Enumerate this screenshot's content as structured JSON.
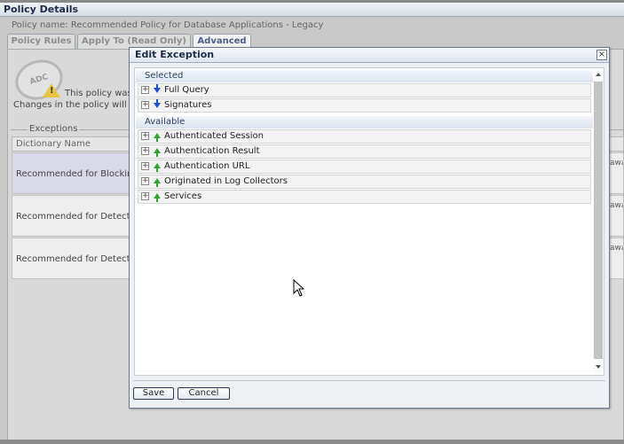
{
  "window": {
    "title": "Policy Details"
  },
  "policy": {
    "name_line": "Policy name: Recommended Policy for Database Applications - Legacy"
  },
  "tabs": [
    {
      "label": "Policy Rules"
    },
    {
      "label": "Apply To (Read Only)"
    },
    {
      "label": "Advanced"
    }
  ],
  "background": {
    "logo_text": "ADC",
    "warning_line1": "This policy was",
    "warning_line2": "Changes in the policy will a",
    "exceptions_legend": "Exceptions",
    "dictionary_header": "Dictionary Name",
    "rows": [
      {
        "name": "Recommended for Blocking"
      },
      {
        "name": "Recommended for Detectio"
      },
      {
        "name": "Recommended for Detectio"
      }
    ],
    "right_cells": [
      "awa",
      "awa",
      "awa"
    ]
  },
  "dialog": {
    "title": "Edit Exception",
    "close_label": "×",
    "sections": {
      "selected_label": "Selected",
      "available_label": "Available"
    },
    "selected_items": [
      {
        "label": "Full Query",
        "icon": "arrow-down-icon"
      },
      {
        "label": "Signatures",
        "icon": "arrow-down-icon"
      }
    ],
    "available_items": [
      {
        "label": "Authenticated Session",
        "icon": "arrow-up-icon"
      },
      {
        "label": "Authentication Result",
        "icon": "arrow-up-icon"
      },
      {
        "label": "Authentication URL",
        "icon": "arrow-up-icon"
      },
      {
        "label": "Originated in Log Collectors",
        "icon": "arrow-up-icon"
      },
      {
        "label": "Services",
        "icon": "arrow-up-icon"
      }
    ],
    "expander_symbol": "+",
    "save_label": "Save",
    "cancel_label": "Cancel"
  },
  "colors": {
    "selected_arrow": "#1f4fd6",
    "available_arrow": "#2fa52f",
    "dialog_border": "#6c7a8c"
  }
}
